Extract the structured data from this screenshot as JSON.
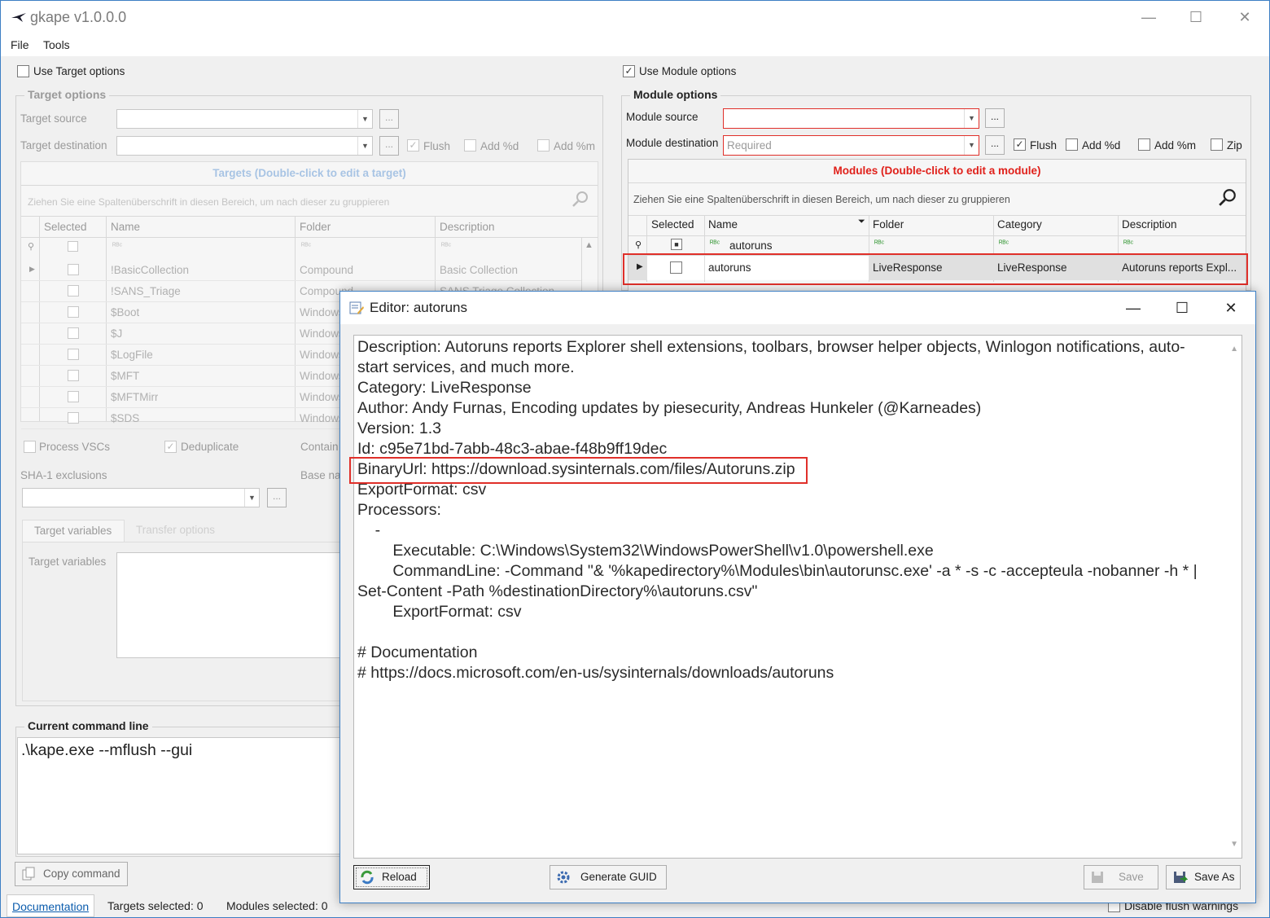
{
  "app": {
    "title": "gkape v1.0.0.0"
  },
  "menu": {
    "file": "File",
    "tools": "Tools"
  },
  "target": {
    "use_label": "Use Target options",
    "group_title": "Target options",
    "source_label": "Target source",
    "destination_label": "Target destination",
    "flush": "Flush",
    "add_d": "Add %d",
    "add_m": "Add %m",
    "grid_title": "Targets (Double-click to edit a target)",
    "group_hint": "Ziehen Sie eine Spaltenüberschrift in diesen Bereich, um nach dieser zu gruppieren",
    "columns": [
      "Selected",
      "Name",
      "Folder",
      "Description"
    ],
    "rows": [
      {
        "name": "!BasicCollection",
        "folder": "Compound",
        "description": "Basic Collection"
      },
      {
        "name": "!SANS_Triage",
        "folder": "Compound",
        "description": "SANS Triage Collection"
      },
      {
        "name": "$Boot",
        "folder": "Windows",
        "description": ""
      },
      {
        "name": "$J",
        "folder": "Windows",
        "description": ""
      },
      {
        "name": "$LogFile",
        "folder": "Windows",
        "description": ""
      },
      {
        "name": "$MFT",
        "folder": "Windows",
        "description": ""
      },
      {
        "name": "$MFTMirr",
        "folder": "Windows",
        "description": ""
      },
      {
        "name": "$SDS",
        "folder": "Windows",
        "description": ""
      }
    ],
    "process_vscs": "Process VSCs",
    "deduplicate": "Deduplicate",
    "container": "Contain",
    "sha1_label": "SHA-1 exclusions",
    "base_name": "Base na",
    "tab_vars": "Target variables",
    "tab_transfer": "Transfer options",
    "vars_label": "Target variables"
  },
  "module": {
    "use_label": "Use Module options",
    "group_title": "Module options",
    "source_label": "Module source",
    "destination_label": "Module destination",
    "destination_placeholder": "Required",
    "flush": "Flush",
    "add_d": "Add %d",
    "add_m": "Add %m",
    "zip": "Zip",
    "grid_title": "Modules (Double-click to edit a module)",
    "group_hint": "Ziehen Sie eine Spaltenüberschrift in diesen Bereich, um nach dieser zu gruppieren",
    "columns": [
      "Selected",
      "Name",
      "Folder",
      "Category",
      "Description"
    ],
    "filter_name": "autoruns",
    "row": {
      "name": "autoruns",
      "folder": "LiveResponse",
      "category": "LiveResponse",
      "description": "Autoruns reports Expl..."
    }
  },
  "command": {
    "title": "Current command line",
    "text": ".\\kape.exe --mflush --gui",
    "copy_label": "Copy command"
  },
  "status": {
    "documentation": "Documentation",
    "targets_selected": "Targets selected: 0",
    "modules_selected": "Modules selected: 0",
    "disable_flush": "Disable flush warnings"
  },
  "editor": {
    "title": "Editor: autoruns",
    "lines": [
      "Description: Autoruns reports Explorer shell extensions, toolbars, browser helper objects, Winlogon notifications, auto-",
      "start services, and much more.",
      "Category: LiveResponse",
      "Author: Andy Furnas, Encoding updates by piesecurity, Andreas Hunkeler (@Karneades)",
      "Version: 1.3",
      "Id: c95e71bd-7abb-48c3-abae-f48b9ff19dec",
      "BinaryUrl: https://download.sysinternals.com/files/Autoruns.zip",
      "ExportFormat: csv",
      "Processors:",
      "    -",
      "        Executable: C:\\Windows\\System32\\WindowsPowerShell\\v1.0\\powershell.exe",
      "        CommandLine: -Command \"& '%kapedirectory%\\Modules\\bin\\autorunsc.exe' -a * -s -c -accepteula -nobanner -h * |",
      "Set-Content -Path %destinationDirectory%\\autoruns.csv\"",
      "        ExportFormat: csv",
      "",
      "# Documentation",
      "# https://docs.microsoft.com/en-us/sysinternals/downloads/autoruns"
    ],
    "reload": "Reload",
    "generate_guid": "Generate GUID",
    "save": "Save",
    "save_as": "Save As"
  },
  "colors": {
    "highlight": "#e0302a",
    "accent": "#3d7fc4",
    "disabled_text": "#9a9a9a"
  }
}
